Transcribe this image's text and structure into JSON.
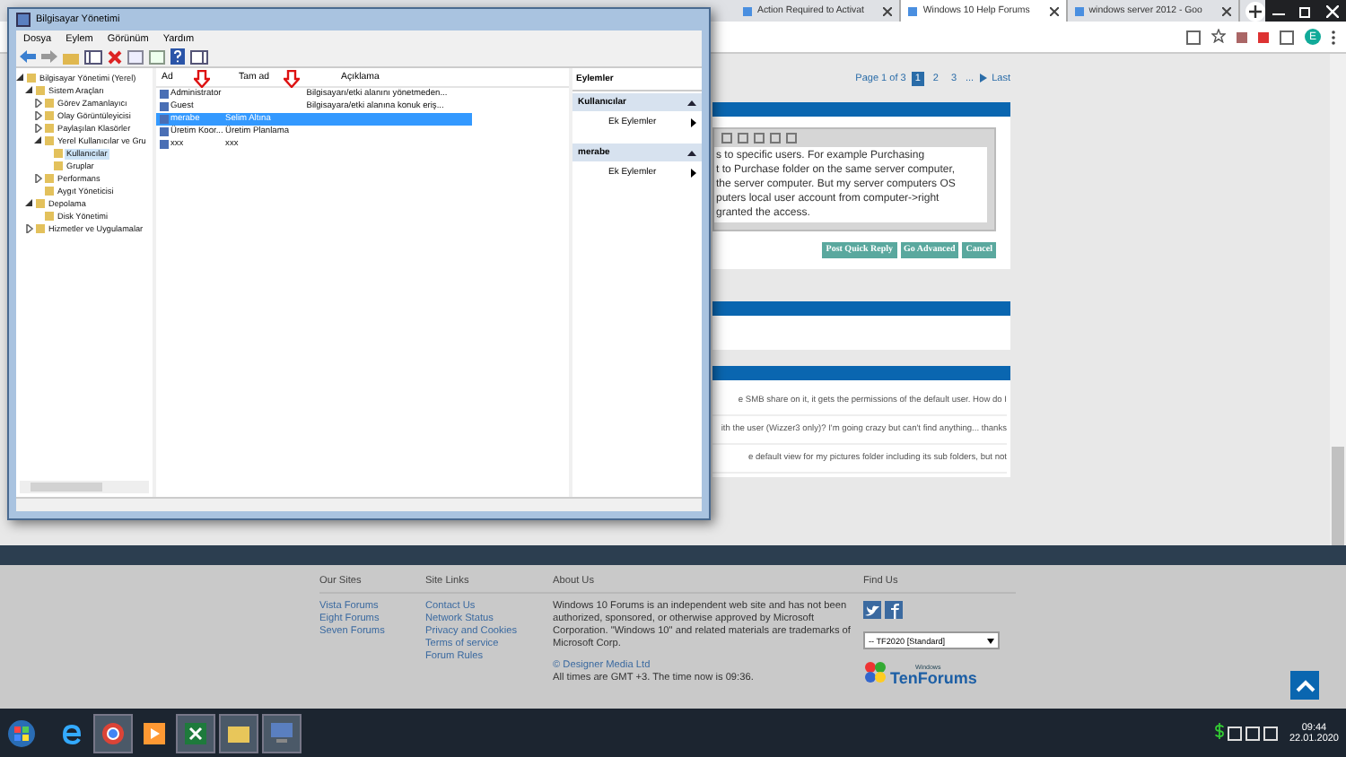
{
  "browser": {
    "tabs": [
      {
        "title": "Action Required to Activat",
        "selected": false
      },
      {
        "title": "Windows 10 Help Forums",
        "selected": true
      },
      {
        "title": "windows server 2012 - Goo",
        "selected": false
      }
    ],
    "profile_initial": "E"
  },
  "pagination": {
    "label": "Page 1 of 3",
    "pages": [
      {
        "label": "1",
        "selected": true
      },
      {
        "label": "2",
        "selected": false
      },
      {
        "label": "3",
        "selected": false
      }
    ],
    "ellipsis": "...",
    "last": "Last"
  },
  "editor": {
    "lines": [
      "s to specific users. For example Purchasing",
      "t to Purchase folder on the same server  computer,",
      "the server computer. But my server computers OS",
      "puters local user account from computer->right",
      "granted the access."
    ]
  },
  "reply_buttons": [
    "Post Quick Reply",
    "Go Advanced",
    "Cancel"
  ],
  "thread_snippets": [
    "e SMB share on it, it gets the permissions of the default user. How do I",
    "ith the user (Wizzer3 only)? I'm going crazy but can't find anything... thanks",
    "e default view for my pictures folder including its sub folders, but not"
  ],
  "footer": {
    "columns": [
      {
        "title": "Our Sites",
        "links": [
          "Vista Forums",
          "Eight Forums",
          "Seven Forums"
        ]
      },
      {
        "title": "Site Links",
        "links": [
          "Contact Us",
          "Network Status",
          "Privacy and Cookies",
          "Terms of service",
          "Forum Rules"
        ]
      }
    ],
    "about": {
      "title": "About Us",
      "text": "Windows 10 Forums is an independent web site and has not been authorized, sponsored, or otherwise approved by Microsoft Corporation. \"Windows 10\" and related materials are trademarks of Microsoft Corp.",
      "copyright": "© Designer Media Ltd",
      "time_note": "All times are GMT +3. The time now is 09:36."
    },
    "find_us": {
      "title": "Find Us",
      "style_select": "-- TF2020 [Standard]",
      "logo_small": "Windows",
      "logo": "TenForums"
    }
  },
  "mmc": {
    "title": "Bilgisayar Yönetimi",
    "menu": [
      "Dosya",
      "Eylem",
      "Görünüm",
      "Yardım"
    ],
    "tree": [
      {
        "label": "Bilgisayar Yönetimi (Yerel)",
        "expanded": true,
        "selected": false,
        "children": [
          {
            "label": "Sistem Araçları",
            "expanded": true,
            "selected": false,
            "children": [
              {
                "label": "Görev Zamanlayıcı",
                "expanded": false,
                "selected": false
              },
              {
                "label": "Olay Görüntüleyicisi",
                "expanded": false,
                "selected": false
              },
              {
                "label": "Paylaşılan Klasörler",
                "expanded": false,
                "selected": false
              },
              {
                "label": "Yerel Kullanıcılar ve Gru",
                "expanded": true,
                "selected": false,
                "children": [
                  {
                    "label": "Kullanıcılar",
                    "selected": true
                  },
                  {
                    "label": "Gruplar",
                    "selected": false
                  }
                ]
              },
              {
                "label": "Performans",
                "expanded": false,
                "selected": false
              },
              {
                "label": "Aygıt Yöneticisi",
                "selected": false
              }
            ]
          },
          {
            "label": "Depolama",
            "expanded": true,
            "selected": false,
            "children": [
              {
                "label": "Disk Yönetimi",
                "selected": false
              }
            ]
          },
          {
            "label": "Hizmetler ve Uygulamalar",
            "expanded": false,
            "selected": false
          }
        ]
      }
    ],
    "columns": [
      "Ad",
      "Tam ad",
      "Açıklama"
    ],
    "rows": [
      {
        "cells": [
          "Administrator",
          "",
          "Bilgisayarı/etki alanını yönetmeden..."
        ],
        "selected": false
      },
      {
        "cells": [
          "Guest",
          "",
          "Bilgisayara/etki alanına konuk eriş..."
        ],
        "selected": false
      },
      {
        "cells": [
          "merabe",
          "Selim Altına",
          ""
        ],
        "selected": true
      },
      {
        "cells": [
          "Üretim Koor...",
          "Üretim Planlama",
          ""
        ],
        "selected": false
      },
      {
        "cells": [
          "xxx",
          "xxx",
          ""
        ],
        "selected": false
      }
    ],
    "actions": {
      "title": "Eylemler",
      "sections": [
        {
          "title": "Kullanıcılar",
          "items": [
            "Ek Eylemler"
          ]
        },
        {
          "title": "merabe",
          "items": [
            "Ek Eylemler"
          ]
        }
      ]
    }
  },
  "taskbar": {
    "time": "09:44",
    "date": "22.01.2020"
  }
}
